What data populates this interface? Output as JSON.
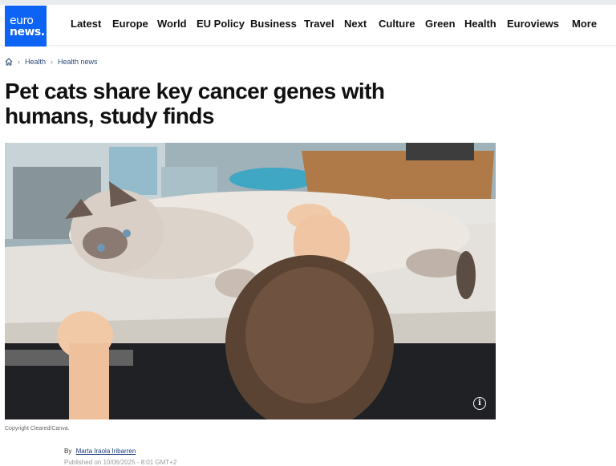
{
  "logo": {
    "line1": "euro",
    "line2": "news."
  },
  "nav": {
    "items": [
      "Latest",
      "Europe",
      "World",
      "EU Policy",
      "Business",
      "Travel",
      "Next",
      "Culture",
      "Green",
      "Health",
      "Euroviews"
    ],
    "more_label": "More"
  },
  "breadcrumb": {
    "home_icon": "home-icon",
    "items": [
      "Health",
      "Health news"
    ]
  },
  "article": {
    "title": "Pet cats share key cancer genes with humans, study finds",
    "image_caption": "Copyright Cleared/Canva.",
    "byline_prefix": "By",
    "author": "Marta Iraola Iribarren",
    "date_partial": "Published on 10/06/2025 - 8:01 GMT+2"
  },
  "colors": {
    "brand": "#0d63f3"
  }
}
